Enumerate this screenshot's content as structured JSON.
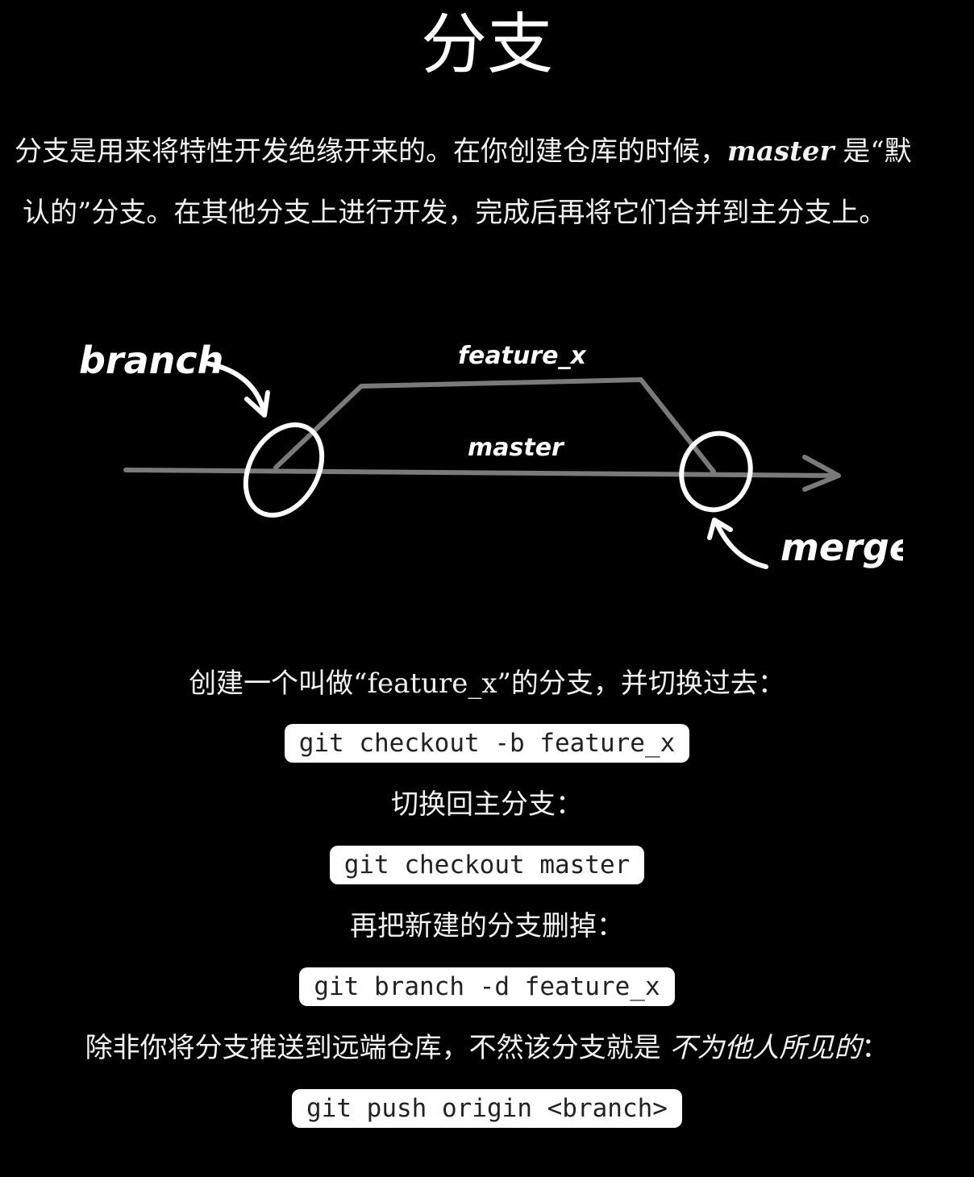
{
  "title": "分支",
  "intro": {
    "line1_before": "分支是用来将特性开发绝缘开来的。在你创建仓库的时候，",
    "line1_em": "master",
    "line1_after": " 是“默",
    "line2": "认的”分支。在其他分支上进行开发，完成后再将它们合并到主分支上。"
  },
  "diagram": {
    "label_branch": "branch",
    "label_feature": "feature_x",
    "label_master": "master",
    "label_merge": "merge"
  },
  "steps": [
    {
      "label": "创建一个叫做“feature_x”的分支，并切换过去：",
      "code": "git checkout -b feature_x"
    },
    {
      "label": "切换回主分支：",
      "code": "git checkout master"
    },
    {
      "label": "再把新建的分支删掉：",
      "code": "git branch -d feature_x"
    },
    {
      "label_before": "除非你将分支推送到远端仓库，不然该分支就是 ",
      "label_em": "不为他人所见的",
      "label_after": "：",
      "code": "git push origin <branch>"
    }
  ]
}
